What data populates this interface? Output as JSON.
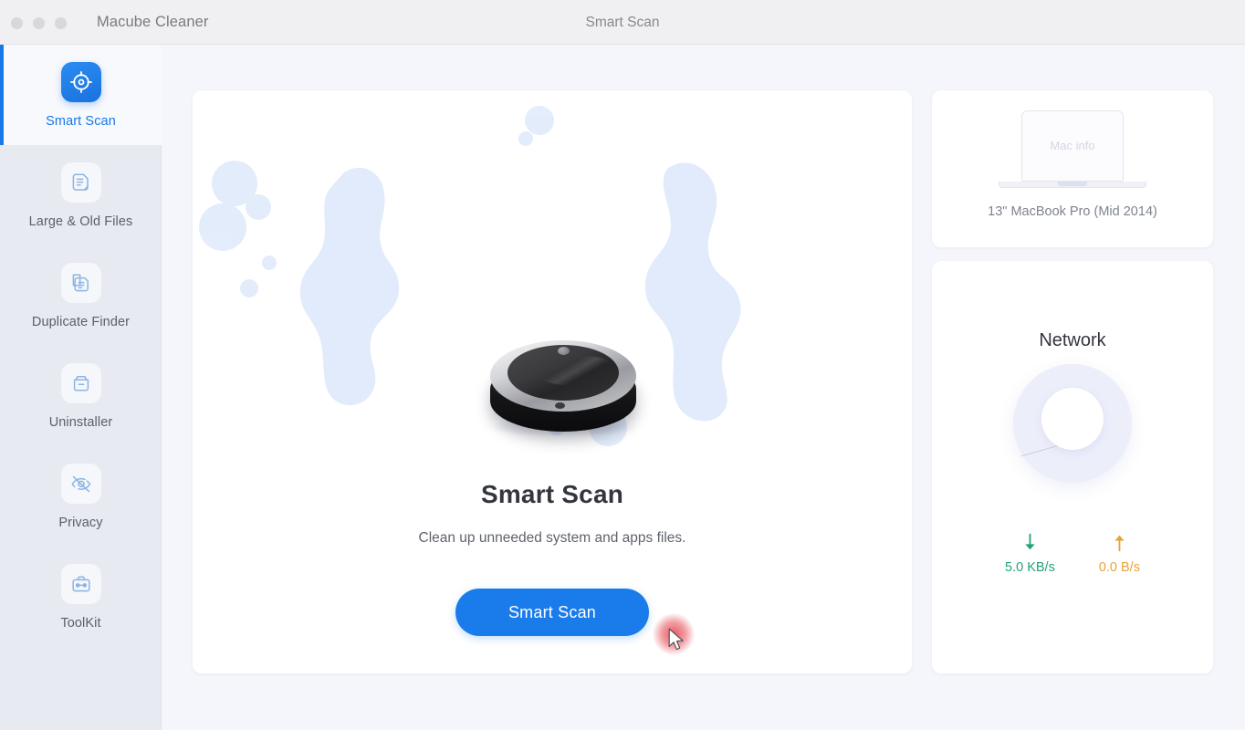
{
  "window": {
    "app_name": "Macube Cleaner",
    "title": "Smart Scan",
    "traffic_lights": [
      "close-button",
      "minimize-button",
      "zoom-button"
    ]
  },
  "sidebar": {
    "items": [
      {
        "label": "Smart Scan",
        "icon": "target-scan-icon",
        "active": true
      },
      {
        "label": "Large & Old Files",
        "icon": "document-icon",
        "active": false
      },
      {
        "label": "Duplicate Finder",
        "icon": "duplicate-files-icon",
        "active": false
      },
      {
        "label": "Uninstaller",
        "icon": "archive-box-icon",
        "active": false
      },
      {
        "label": "Privacy",
        "icon": "eye-off-icon",
        "active": false
      },
      {
        "label": "ToolKit",
        "icon": "toolbox-icon",
        "active": false
      }
    ]
  },
  "main": {
    "illustration": "robot-vacuum-illustration",
    "title": "Smart Scan",
    "subtitle": "Clean up unneeded system and apps files.",
    "button_label": "Smart Scan"
  },
  "mac_info": {
    "screen_label": "Mac info",
    "model": "13\" MacBook Pro (Mid 2014)"
  },
  "network": {
    "title": "Network",
    "download": {
      "value": "5.0 KB/s",
      "icon": "arrow-down-icon",
      "color": "#23a179"
    },
    "upload": {
      "value": "0.0 B/s",
      "icon": "arrow-up-icon",
      "color": "#e8a337"
    }
  },
  "cursor": {
    "click_indicator": "red-click-highlight",
    "pointer": "mouse-cursor"
  },
  "colors": {
    "accent_blue": "#1a7ceb",
    "sidebar_bg": "#e7eaf0",
    "page_bg": "#f5f6fb",
    "download_green": "#23a179",
    "upload_amber": "#e8a337"
  }
}
